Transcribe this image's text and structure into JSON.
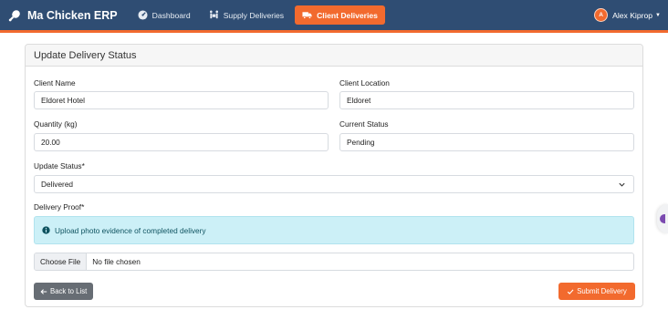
{
  "navbar": {
    "brand": "Ma Chicken ERP",
    "brand_icon": "drumstick-icon",
    "links": [
      {
        "label": "Dashboard",
        "icon": "dashboard-gauge-icon"
      },
      {
        "label": "Supply Deliveries",
        "icon": "people-carry-icon"
      },
      {
        "label": "Client Deliveries",
        "icon": "truck-icon",
        "active": true
      }
    ],
    "user": {
      "initial": "A",
      "name": "Alex Kiprop"
    }
  },
  "card": {
    "title": "Update Delivery Status",
    "client_name_label": "Client Name",
    "client_name_value": "Eldoret Hotel",
    "client_location_label": "Client Location",
    "client_location_value": "Eldoret",
    "quantity_label": "Quantity (kg)",
    "quantity_value": "20.00",
    "current_status_label": "Current Status",
    "current_status_value": "Pending",
    "update_status_label": "Update Status*",
    "update_status_value": "Delivered",
    "delivery_proof_label": "Delivery Proof*",
    "proof_info": "Upload photo evidence of completed delivery",
    "file_button": "Choose File",
    "file_status": "No file chosen",
    "back_button": "Back to List",
    "submit_button": "Submit Delivery"
  },
  "colors": {
    "navbar": "#2f4d73",
    "accent": "#f26a2e",
    "info_bg": "#ccf0f7",
    "secondary": "#676d74"
  }
}
